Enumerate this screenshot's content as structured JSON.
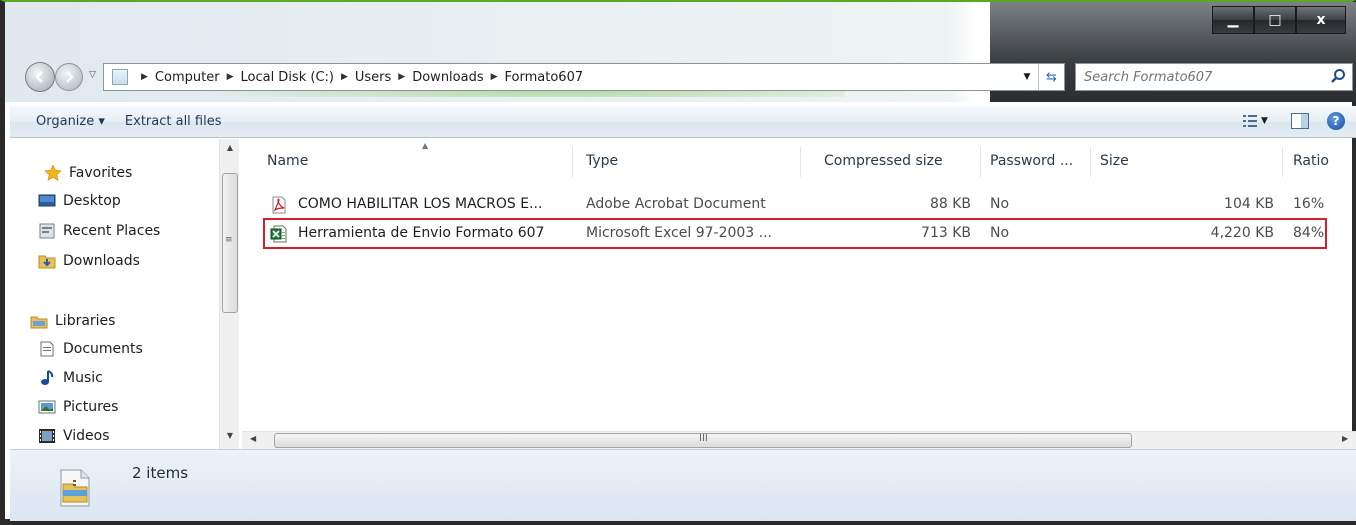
{
  "window": {
    "minimize": "▁",
    "maximize": "□",
    "close": "x"
  },
  "breadcrumb": [
    "Computer",
    "Local Disk (C:)",
    "Users",
    "Downloads",
    "Formato607"
  ],
  "search": {
    "placeholder": "Search Formato607"
  },
  "toolbar": {
    "organize": "Organize ▾",
    "extract": "Extract all files"
  },
  "sidebar": {
    "favorites": {
      "label": "Favorites",
      "items": [
        {
          "label": "Desktop",
          "icon": "desktop-icon"
        },
        {
          "label": "Recent Places",
          "icon": "recent-places-icon"
        },
        {
          "label": "Downloads",
          "icon": "downloads-icon"
        }
      ]
    },
    "libraries": {
      "label": "Libraries",
      "items": [
        {
          "label": "Documents",
          "icon": "documents-icon"
        },
        {
          "label": "Music",
          "icon": "music-icon"
        },
        {
          "label": "Pictures",
          "icon": "pictures-icon"
        },
        {
          "label": "Videos",
          "icon": "videos-icon"
        }
      ]
    }
  },
  "table": {
    "columns": [
      "Name",
      "Type",
      "Compressed size",
      "Password ...",
      "Size",
      "Ratio"
    ],
    "rows": [
      {
        "name": "COMO HABILITAR LOS MACROS E...",
        "type": "Adobe Acrobat Document",
        "compressed": "88 KB",
        "password": "No",
        "size": "104 KB",
        "ratio": "16%",
        "icon": "pdf-icon"
      },
      {
        "name": "Herramienta de Envio Formato 607",
        "type": "Microsoft Excel 97-2003 ...",
        "compressed": "713 KB",
        "password": "No",
        "size": "4,220 KB",
        "ratio": "84%",
        "icon": "excel-icon"
      }
    ]
  },
  "hscroll": {
    "grip": "III"
  },
  "status": {
    "count": "2 items"
  },
  "colors": {
    "highlight": "#d3202a",
    "accent": "#5aa826"
  }
}
